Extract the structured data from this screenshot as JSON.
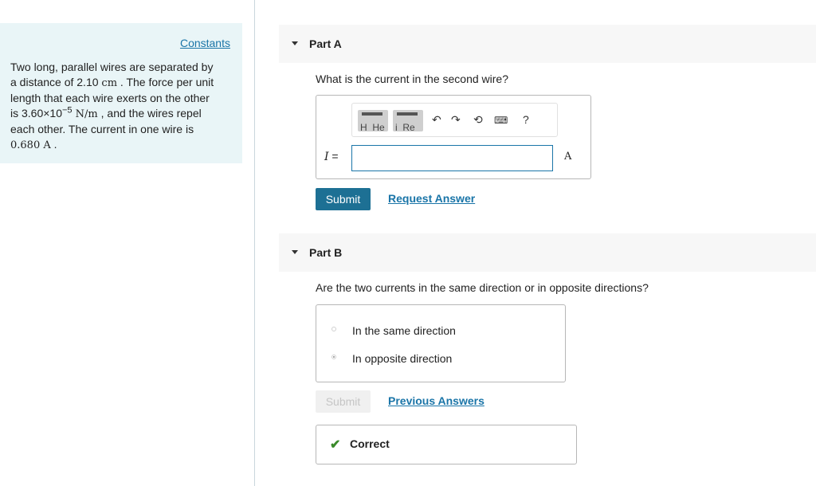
{
  "left": {
    "constants_label": "Constants",
    "problem": {
      "line1": "Two long, parallel wires are separated by",
      "l2a": "a distance of 2.10 ",
      "l2unit": "cm",
      "l2b": " . The force per unit",
      "line3": "length that each wire exerts on the other",
      "l4a": "is 3.60×10",
      "l4exp": "−5",
      "l4unit": " N/m",
      "l4b": " , and the wires repel",
      "line5": "each other. The current in one wire is",
      "l6val": "0.680 A",
      "l6b": " ."
    }
  },
  "partA": {
    "title": "Part A",
    "question": "What is the current in the second wire?",
    "toolbar": {
      "templates_label": "H_He",
      "symbols_label": "i_Re",
      "undo_icon": "undo-icon",
      "redo_icon": "redo-icon",
      "reset_icon": "reset-icon",
      "keyboard_icon": "keyboard-icon",
      "help_label": "?"
    },
    "var_label": "I",
    "equals": "=",
    "input_value": "",
    "unit": "A",
    "submit_label": "Submit",
    "request_label": "Request Answer"
  },
  "partB": {
    "title": "Part B",
    "question": "Are the two currents in the same direction or in opposite directions?",
    "options": [
      {
        "label": "In the same direction",
        "selected": false
      },
      {
        "label": "In opposite direction",
        "selected": true
      }
    ],
    "submit_label": "Submit",
    "previous_label": "Previous Answers",
    "feedback": "Correct"
  },
  "colors": {
    "accent": "#1d7094",
    "link": "#1a75a8",
    "panel_bg": "#e9f5f7",
    "correct": "#3a8a2a"
  }
}
